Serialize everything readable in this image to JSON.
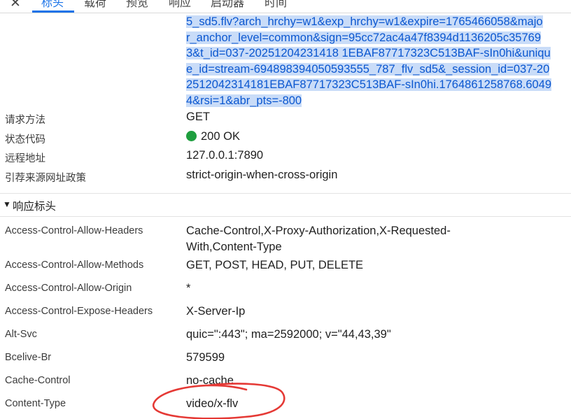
{
  "tabs": {
    "close": "✕",
    "items": [
      "标头",
      "载荷",
      "预览",
      "响应",
      "启动器",
      "时间"
    ]
  },
  "request_url_lines": [
    "5_sd5.flv?arch_hrchy=w1&exp_hrchy=w1&expire=1765466058&majo",
    "r_anchor_level=common&sign=95cc72ac4a47f8394d1136205c35769",
    "3&t_id=037-20251204231418 1EBAF87717323C513BAF-sIn0hi&uniqu",
    "e_id=stream-694898394050593555_787_flv_sd5&_session_id=037-20",
    "2512042314181EBAF87717323C513BAF-sIn0hi.1764861258768.6049",
    "4&rsi=1&abr_pts=-800"
  ],
  "general": [
    {
      "key": "请求方法",
      "value": "GET"
    },
    {
      "key": "状态代码",
      "value": "200 OK",
      "status_color": "#1e9e3e"
    },
    {
      "key": "远程地址",
      "value": "127.0.0.1:7890"
    },
    {
      "key": "引荐来源网址政策",
      "value": "strict-origin-when-cross-origin"
    }
  ],
  "response_headers_section": {
    "arrow": "▼",
    "title": "响应标头"
  },
  "response_headers": [
    {
      "key": "Access-Control-Allow-Headers",
      "value": "Cache-Control,X-Proxy-Authorization,X-Requested-With,Content-Type"
    },
    {
      "key": "Access-Control-Allow-Methods",
      "value": "GET, POST, HEAD, PUT, DELETE"
    },
    {
      "key": "Access-Control-Allow-Origin",
      "value": "*"
    },
    {
      "key": "Access-Control-Expose-Headers",
      "value": "X-Server-Ip"
    },
    {
      "key": "Alt-Svc",
      "value": "quic=\":443\"; ma=2592000; v=\"44,43,39\""
    },
    {
      "key": "Bcelive-Br",
      "value": "579599"
    },
    {
      "key": "Cache-Control",
      "value": "no-cache"
    },
    {
      "key": "Content-Type",
      "value": "video/x-flv"
    }
  ],
  "colors": {
    "accent": "#1a73e8",
    "url_text": "#0b57d0",
    "url_highlight": "#c9dcf8",
    "annotation": "#e53935"
  }
}
